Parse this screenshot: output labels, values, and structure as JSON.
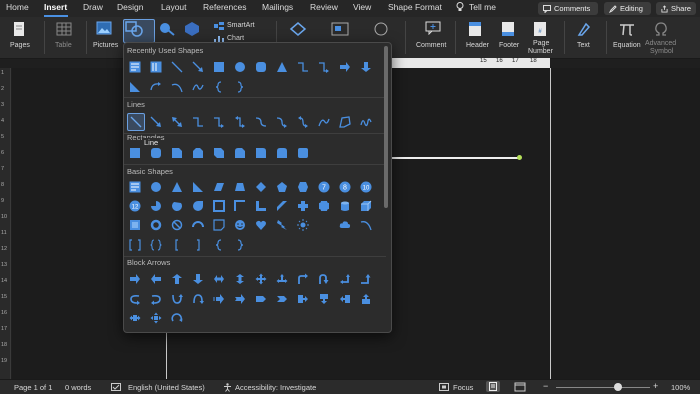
{
  "menu": {
    "tabs": [
      "Home",
      "Insert",
      "Draw",
      "Design",
      "Layout",
      "References",
      "Mailings",
      "Review",
      "View",
      "Shape Format"
    ],
    "tell_me": "Tell me",
    "comments": "Comments",
    "editing": "Editing",
    "share": "Share"
  },
  "ribbon": {
    "pages": "Pages",
    "table": "Table",
    "pictures": "Pictures",
    "smartart": "SmartArt",
    "chart": "Chart",
    "comment": "Comment",
    "header": "Header",
    "footer": "Footer",
    "page_number_1": "Page",
    "page_number_2": "Number",
    "text": "Text",
    "equation": "Equation",
    "advanced_1": "Advanced",
    "advanced_2": "Symbol"
  },
  "ruler": {
    "nums": [
      "15",
      "16",
      "17",
      "18"
    ]
  },
  "left_ruler": {
    "nums": [
      "1",
      "2",
      "3",
      "4",
      "5",
      "6",
      "7",
      "8",
      "9",
      "10",
      "11",
      "12",
      "13",
      "14",
      "15",
      "16",
      "17",
      "18",
      "19"
    ]
  },
  "gallery": {
    "recent": "Recently Used Shapes",
    "lines": "Lines",
    "rectangles": "Rectangles",
    "basic": "Basic Shapes",
    "block": "Block Arrows",
    "tooltip": "Line",
    "badges": [
      "7",
      "8",
      "10",
      "12"
    ]
  },
  "status": {
    "page": "Page 1 of 1",
    "words": "0 words",
    "language": "English (United States)",
    "accessibility": "Accessibility: Investigate",
    "focus": "Focus",
    "zoom": "100%"
  },
  "colors": {
    "accent": "#4a90e2",
    "shape_blue": "#4a8fe0",
    "line_green": "#b6e05a"
  }
}
